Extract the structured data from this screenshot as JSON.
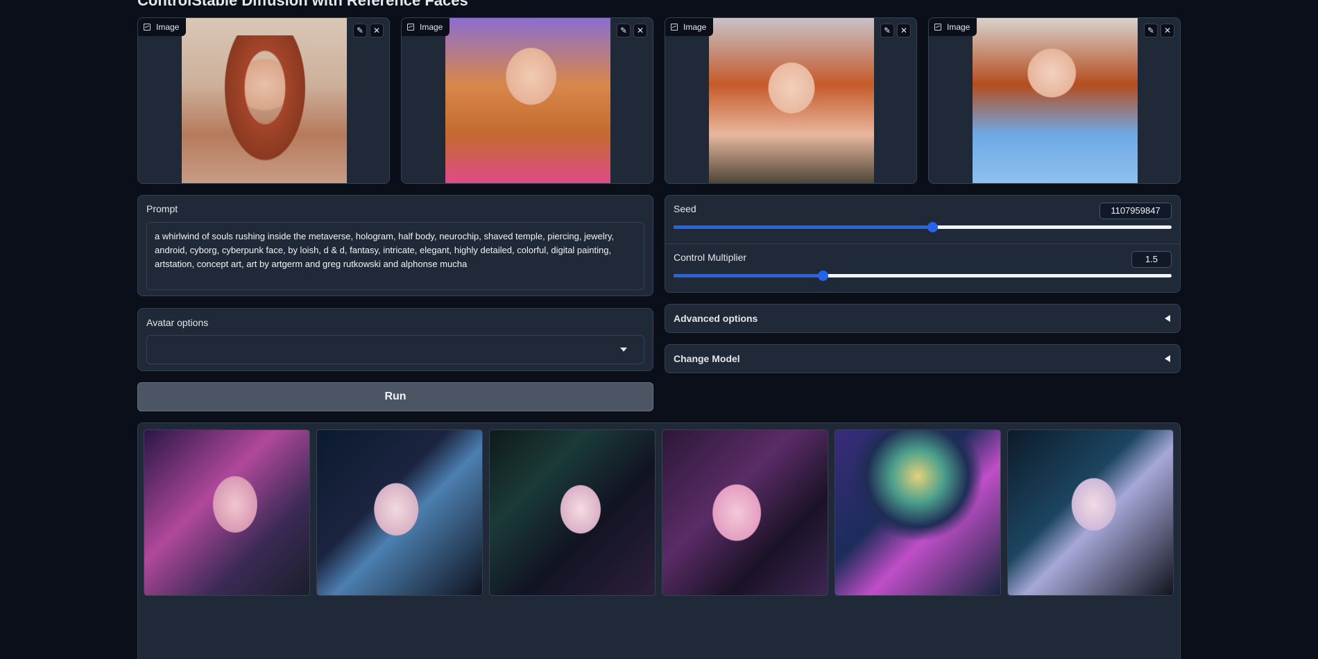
{
  "page_title": "ControlStable Diffusion with Reference Faces",
  "reference_images": [
    {
      "label": "Image",
      "edit_icon": "pencil-icon",
      "clear_icon": "close-icon"
    },
    {
      "label": "Image",
      "edit_icon": "pencil-icon",
      "clear_icon": "close-icon"
    },
    {
      "label": "Image",
      "edit_icon": "pencil-icon",
      "clear_icon": "close-icon"
    },
    {
      "label": "Image",
      "edit_icon": "pencil-icon",
      "clear_icon": "close-icon"
    }
  ],
  "prompt": {
    "label": "Prompt",
    "value": "a whirlwind of souls rushing inside the metaverse, hologram, half body, neurochip, shaved temple, piercing, jewelry, android, cyborg, cyberpunk face, by loish, d & d, fantasy, intricate, elegant, highly detailed, colorful, digital painting, artstation, concept art, art by artgerm and greg rutkowski and alphonse mucha"
  },
  "avatar_options": {
    "label": "Avatar options",
    "selected": ""
  },
  "run_button": "Run",
  "seed": {
    "label": "Seed",
    "value": "1107959847",
    "fraction": 0.52
  },
  "control_multiplier": {
    "label": "Control Multiplier",
    "value": "1.5",
    "fraction": 0.3
  },
  "advanced_options": {
    "label": "Advanced options"
  },
  "change_model": {
    "label": "Change Model"
  },
  "gallery": {
    "count": 6
  },
  "colors": {
    "background": "#0b0f19",
    "panel": "#1f2937",
    "accent": "#2563eb"
  }
}
